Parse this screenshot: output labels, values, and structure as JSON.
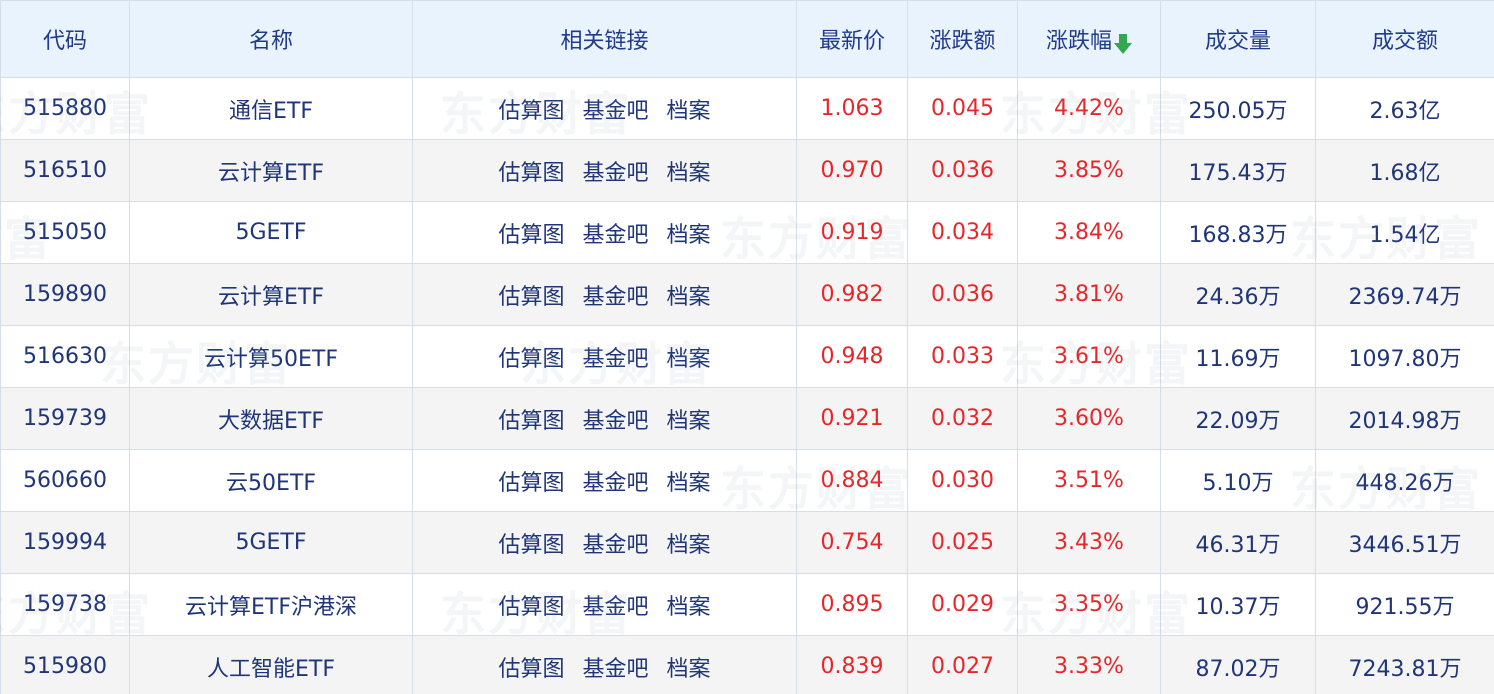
{
  "headers": {
    "code": "代码",
    "name": "名称",
    "links": "相关链接",
    "price": "最新价",
    "change": "涨跌额",
    "change_pct": "涨跌幅",
    "volume": "成交量",
    "amount": "成交额"
  },
  "sort": {
    "column": "change_pct",
    "direction": "desc",
    "icon": "sort-down-arrow-icon",
    "color": "#2fa84f"
  },
  "link_labels": {
    "estimate": "估算图",
    "forum": "基金吧",
    "profile": "档案"
  },
  "watermark": "东方财富",
  "colors": {
    "up": "#e8262a",
    "header_bg": "#e9f3fd",
    "text": "#1f3578"
  },
  "rows": [
    {
      "code": "515880",
      "name": "通信ETF",
      "price": "1.063",
      "change": "0.045",
      "change_pct": "4.42%",
      "volume": "250.05万",
      "amount": "2.63亿"
    },
    {
      "code": "516510",
      "name": "云计算ETF",
      "price": "0.970",
      "change": "0.036",
      "change_pct": "3.85%",
      "volume": "175.43万",
      "amount": "1.68亿"
    },
    {
      "code": "515050",
      "name": "5GETF",
      "price": "0.919",
      "change": "0.034",
      "change_pct": "3.84%",
      "volume": "168.83万",
      "amount": "1.54亿"
    },
    {
      "code": "159890",
      "name": "云计算ETF",
      "price": "0.982",
      "change": "0.036",
      "change_pct": "3.81%",
      "volume": "24.36万",
      "amount": "2369.74万"
    },
    {
      "code": "516630",
      "name": "云计算50ETF",
      "price": "0.948",
      "change": "0.033",
      "change_pct": "3.61%",
      "volume": "11.69万",
      "amount": "1097.80万"
    },
    {
      "code": "159739",
      "name": "大数据ETF",
      "price": "0.921",
      "change": "0.032",
      "change_pct": "3.60%",
      "volume": "22.09万",
      "amount": "2014.98万"
    },
    {
      "code": "560660",
      "name": "云50ETF",
      "price": "0.884",
      "change": "0.030",
      "change_pct": "3.51%",
      "volume": "5.10万",
      "amount": "448.26万"
    },
    {
      "code": "159994",
      "name": "5GETF",
      "price": "0.754",
      "change": "0.025",
      "change_pct": "3.43%",
      "volume": "46.31万",
      "amount": "3446.51万"
    },
    {
      "code": "159738",
      "name": "云计算ETF沪港深",
      "price": "0.895",
      "change": "0.029",
      "change_pct": "3.35%",
      "volume": "10.37万",
      "amount": "921.55万"
    },
    {
      "code": "515980",
      "name": "人工智能ETF",
      "price": "0.839",
      "change": "0.027",
      "change_pct": "3.33%",
      "volume": "87.02万",
      "amount": "7243.81万"
    }
  ]
}
